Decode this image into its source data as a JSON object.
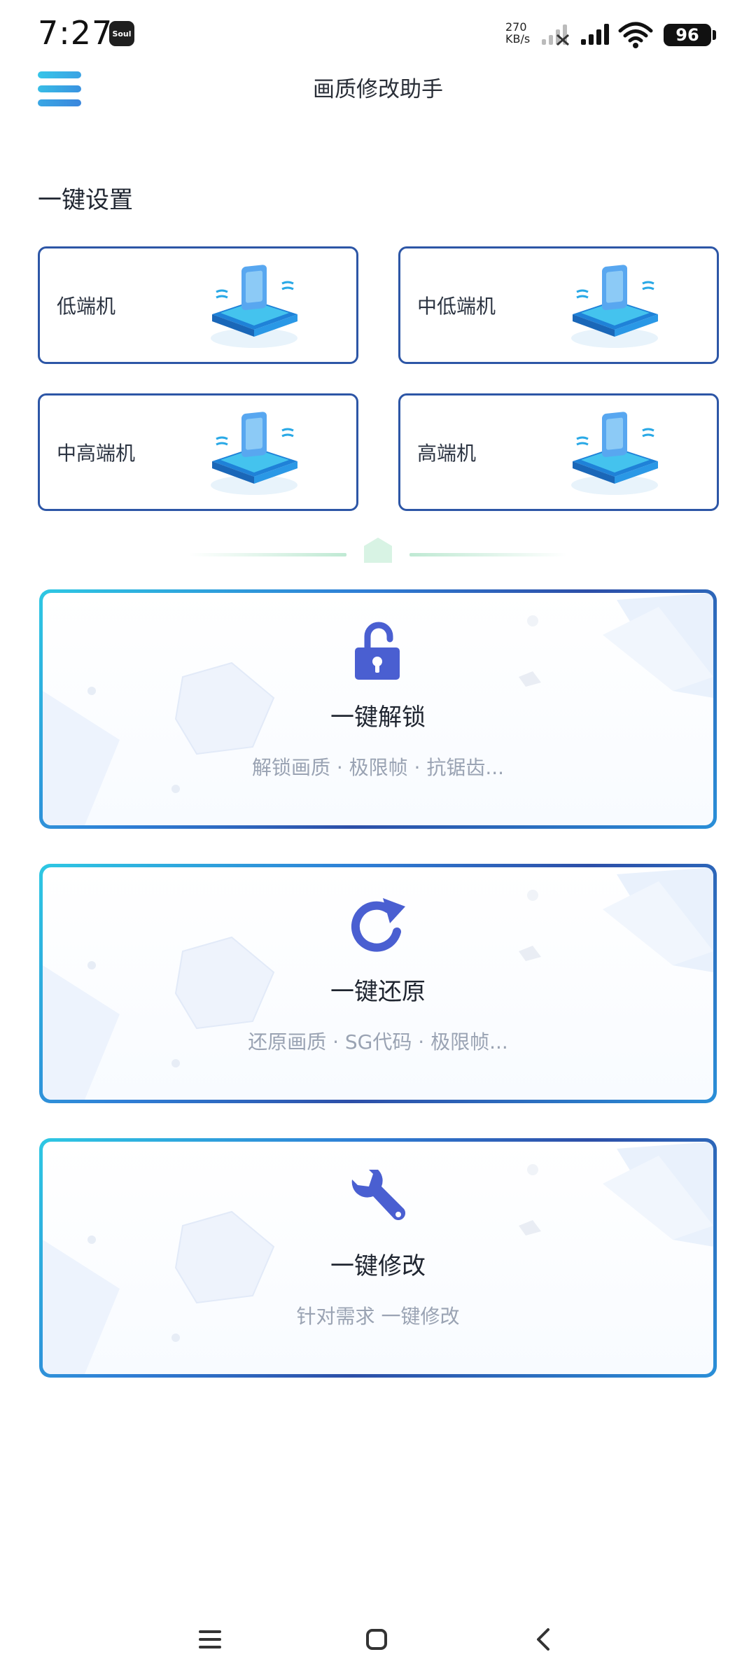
{
  "status_bar": {
    "time": "7:27",
    "app_badge": "Soul",
    "net_speed_value": "270",
    "net_speed_unit": "KB/s",
    "battery": "96"
  },
  "header": {
    "title": "画质修改助手",
    "menu_icon": "hamburger-menu-icon"
  },
  "presets": {
    "title": "一键设置",
    "items": [
      {
        "label": "低端机",
        "icon": "phone-platform-illustration"
      },
      {
        "label": "中低端机",
        "icon": "phone-platform-illustration"
      },
      {
        "label": "中高端机",
        "icon": "phone-platform-illustration"
      },
      {
        "label": "高端机",
        "icon": "phone-platform-illustration"
      }
    ]
  },
  "actions": [
    {
      "title": "一键解锁",
      "subtitle": "解锁画质 · 极限帧 · 抗锯齿...",
      "icon": "unlock-icon"
    },
    {
      "title": "一键还原",
      "subtitle": "还原画质 · SG代码 · 极限帧...",
      "icon": "refresh-icon"
    },
    {
      "title": "一键修改",
      "subtitle": "针对需求 一键修改",
      "icon": "wrench-icon"
    }
  ],
  "colors": {
    "accent_blue": "#2d56a6",
    "icon_blue": "#4b5fd1",
    "menu_cyan": "#38c6e6",
    "menu_blue": "#3a8fe0"
  },
  "nav": {
    "items": [
      "recent-apps-icon",
      "home-icon",
      "back-icon"
    ]
  }
}
